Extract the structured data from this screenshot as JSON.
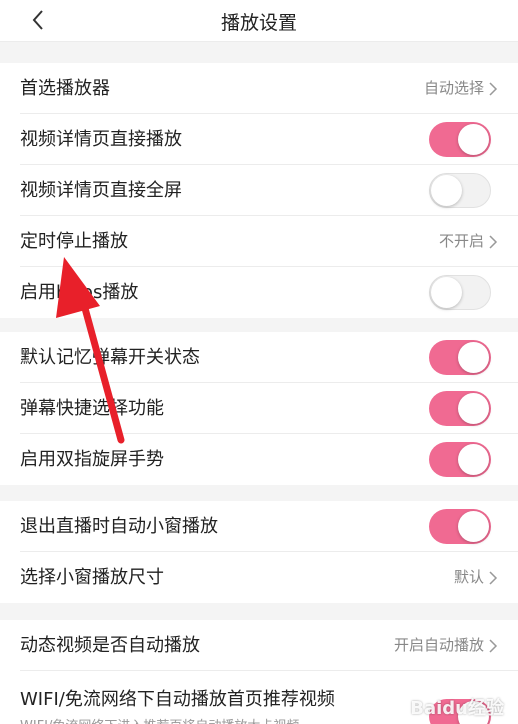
{
  "header": {
    "title": "播放设置"
  },
  "groups": [
    {
      "rows": [
        {
          "label": "首选播放器",
          "value": "自动选择"
        },
        {
          "label": "视频详情页直接播放",
          "toggle": "on"
        },
        {
          "label": "视频详情页直接全屏",
          "toggle": "off"
        },
        {
          "label": "定时停止播放",
          "value": "不开启"
        },
        {
          "label": "启用https播放",
          "toggle": "off"
        }
      ]
    },
    {
      "rows": [
        {
          "label": "默认记忆弹幕开关状态",
          "toggle": "on"
        },
        {
          "label": "弹幕快捷选择功能",
          "toggle": "on"
        },
        {
          "label": "启用双指旋屏手势",
          "toggle": "on"
        }
      ]
    },
    {
      "rows": [
        {
          "label": "退出直播时自动小窗播放",
          "toggle": "on"
        },
        {
          "label": "选择小窗播放尺寸",
          "value": "默认"
        }
      ]
    },
    {
      "rows": [
        {
          "label": "动态视频是否自动播放",
          "value": "开启自动播放"
        },
        {
          "label": "WIFI/免流网络下自动播放首页推荐视频",
          "sublabel": "WIFI/免流网络下进入推荐页将自动播放大卡视频",
          "toggle": "on"
        }
      ]
    }
  ],
  "colors": {
    "accent": "#f06a92",
    "annotation_arrow": "#e8202a"
  },
  "watermark": "Baidu经验"
}
